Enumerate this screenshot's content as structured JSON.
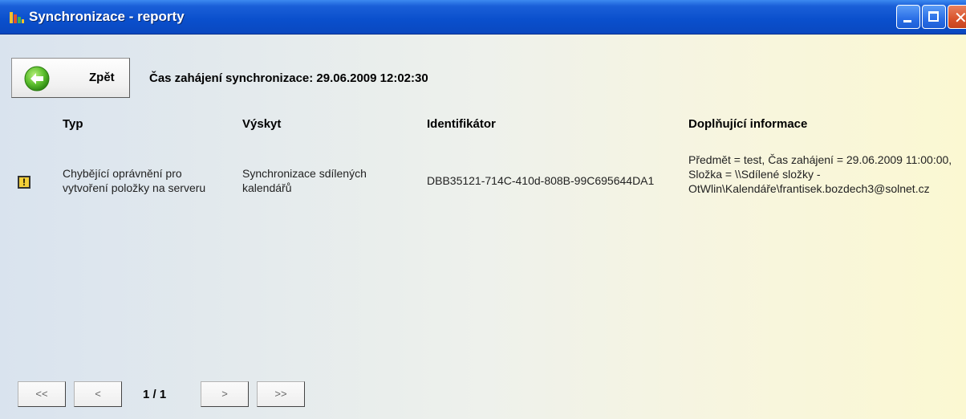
{
  "window": {
    "title": "Synchronizace - reporty"
  },
  "toolbar": {
    "back_label": "Zpět",
    "sync_start": "Čas zahájení synchronizace: 29.06.2009 12:02:30"
  },
  "table": {
    "headers": [
      "Typ",
      "Výskyt",
      "Identifikátor",
      "Doplňující informace"
    ],
    "rows": [
      {
        "status_icon": "warning-icon",
        "type": "Chybějící oprávnění pro vytvoření položky na serveru",
        "occurrence": "Synchronizace sdílených kalendářů",
        "identifier": "DBB35121-714C-410d-808B-99C695644DA1",
        "info": "Předmět = test, Čas zahájení = 29.06.2009 11:00:00, Složka = \\\\Sdílené složky - OtWlin\\Kalendáře\\frantisek.bozdech3@solnet.cz"
      }
    ]
  },
  "pagination": {
    "first_label": "<<",
    "prev_label": "<",
    "page": "1 / 1",
    "next_label": ">",
    "last_label": ">>"
  },
  "colors": {
    "titlebar": "#0a4fcc",
    "warning": "#f4d03a"
  }
}
